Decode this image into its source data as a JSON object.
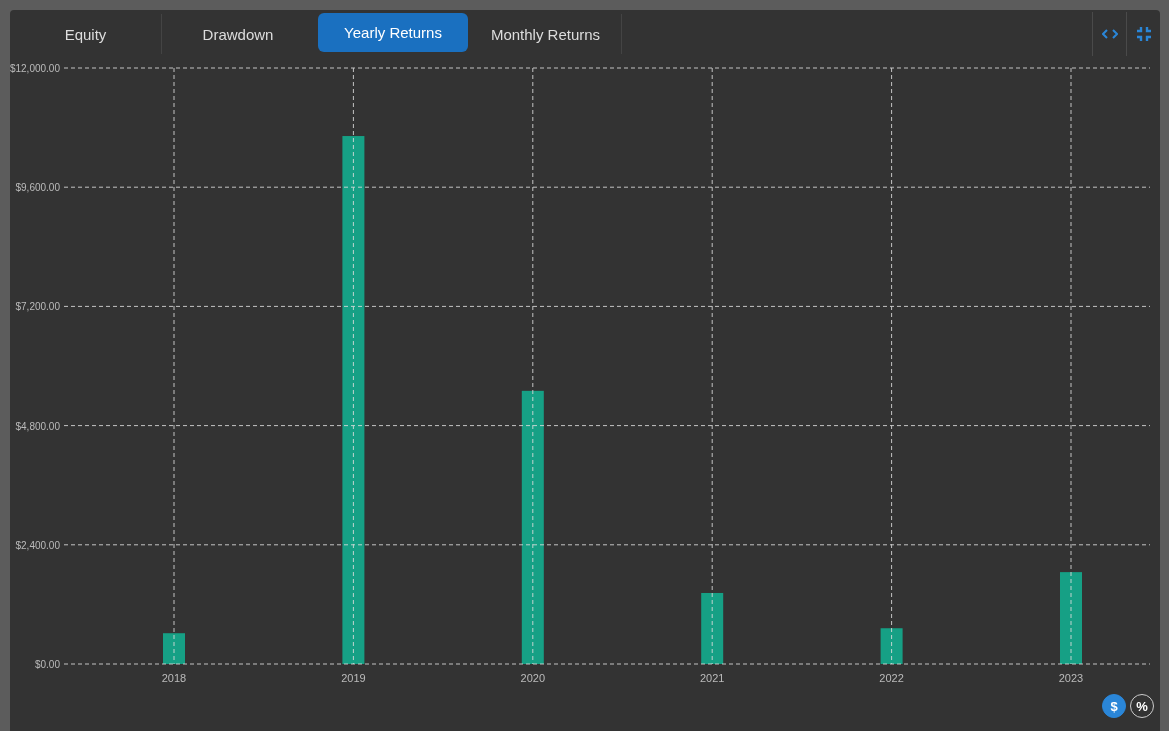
{
  "tabs": [
    {
      "label": "Equity",
      "selected": false
    },
    {
      "label": "Drawdown",
      "selected": false
    },
    {
      "label": "Yearly Returns",
      "selected": true
    },
    {
      "label": "Monthly Returns",
      "selected": false
    }
  ],
  "chart_data": {
    "type": "bar",
    "categories": [
      "2018",
      "2019",
      "2020",
      "2021",
      "2022",
      "2023"
    ],
    "grid": true,
    "series": [
      {
        "color": "#16a085",
        "values": [
          620,
          10630,
          5500,
          1430,
          720,
          1850
        ]
      }
    ],
    "ylim": [
      0,
      12000
    ],
    "yticks": [
      {
        "value": 0,
        "label": "$0.00"
      },
      {
        "value": 2400,
        "label": "$2,400.00"
      },
      {
        "value": 4800,
        "label": "$4,800.00"
      },
      {
        "value": 7200,
        "label": "$7,200.00"
      },
      {
        "value": 9600,
        "label": "$9,600.00"
      },
      {
        "value": 12000,
        "label": "$12,000.00"
      }
    ]
  },
  "units": [
    {
      "label": "$",
      "selected": true
    },
    {
      "label": "%",
      "selected": false
    }
  ]
}
